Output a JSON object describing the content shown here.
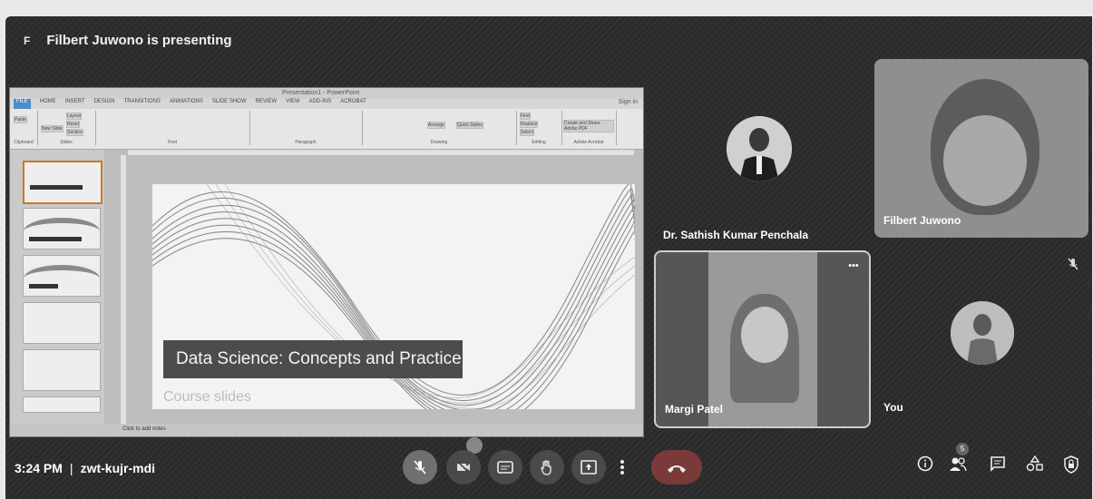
{
  "presenting": {
    "avatar_letter": "F",
    "text": "Filbert Juwono is presenting"
  },
  "shared_screen": {
    "window_title": "Presentation1 - PowerPoint",
    "sign_in": "Sign in",
    "ribbon_tabs": [
      "FILE",
      "HOME",
      "INSERT",
      "DESIGN",
      "TRANSITIONS",
      "ANIMATIONS",
      "SLIDE SHOW",
      "REVIEW",
      "VIEW",
      "ADD-INS",
      "ACROBAT"
    ],
    "ribbon_groups": [
      "Clipboard",
      "Slides",
      "Font",
      "Paragraph",
      "Drawing",
      "Editing",
      "Adobe Acrobat"
    ],
    "ribbon_buttons": {
      "paste": "Paste",
      "new_slide": "New Slide",
      "layout": "Layout",
      "reset": "Reset",
      "section": "Section",
      "arrange": "Arrange",
      "quick_styles": "Quick Styles",
      "find": "Find",
      "replace": "Replace",
      "select": "Select",
      "create_pdf": "Create and Share Adobe PDF"
    },
    "slide_numbers": [
      "1",
      "2",
      "3",
      "4",
      "5",
      "6"
    ],
    "slide": {
      "title": "Data Science: Concepts and Practice",
      "subtitle": "Course slides"
    },
    "notes_placeholder": "Click to add notes"
  },
  "participants": [
    {
      "name": "Dr. Sathish Kumar Penchala"
    },
    {
      "name": "Filbert Juwono"
    },
    {
      "name": "Margi Patel",
      "menu": "•••"
    },
    {
      "name": "You"
    }
  ],
  "bottom_bar": {
    "time": "3:24 PM",
    "separator": "|",
    "meeting_code": "zwt-kujr-mdi",
    "people_count": "5"
  },
  "icons": {
    "mic_off": "mic-off-icon",
    "camera_off": "camera-off-icon",
    "captions": "captions-icon",
    "raise_hand": "hand-icon",
    "present": "present-icon",
    "more": "more-vert-icon",
    "leave": "call-end-icon",
    "info": "info-icon",
    "people": "people-icon",
    "chat": "chat-icon",
    "activities": "shapes-icon",
    "host_controls": "lock-shield-icon"
  },
  "colors": {
    "background": "#2a2a2a",
    "leave_button": "#7a3a3a",
    "slide_title_box": "#4c4c4c"
  }
}
